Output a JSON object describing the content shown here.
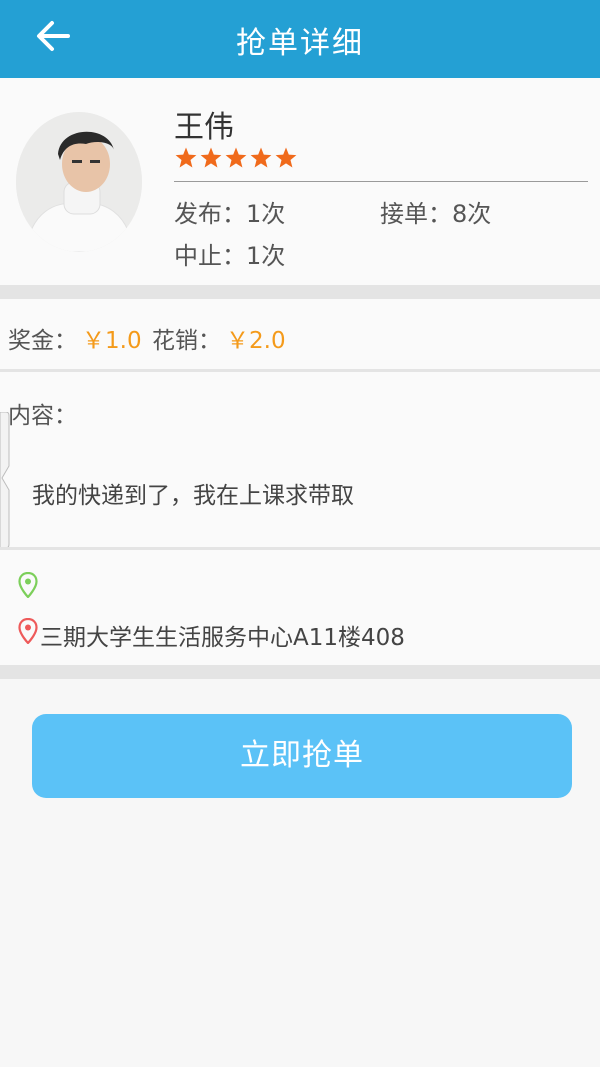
{
  "header": {
    "title": "抢单详细",
    "back_icon": "arrow-left-icon"
  },
  "profile": {
    "name": "王伟",
    "rating": 5,
    "rating_max": 5,
    "star_color": "#f06a1b",
    "publish": "发布：1次",
    "accept": "接单：8次",
    "abort": "中止：1次"
  },
  "reward": {
    "bonus_label": "奖金：",
    "bonus_value": "￥1.0",
    "cost_label": "花销：",
    "cost_value": "￥2.0",
    "value_color": "#f49a1a"
  },
  "content": {
    "label": "内容：",
    "text": "我的快递到了，我在上课求带取"
  },
  "address": {
    "from_icon": "location-pin-green-icon",
    "to_icon": "location-pin-red-icon",
    "from_text": "",
    "to_text": "三期大学生生活服务中心A11楼408"
  },
  "action": {
    "grab_label": "立即抢单",
    "button_color": "#5bc2f7"
  }
}
